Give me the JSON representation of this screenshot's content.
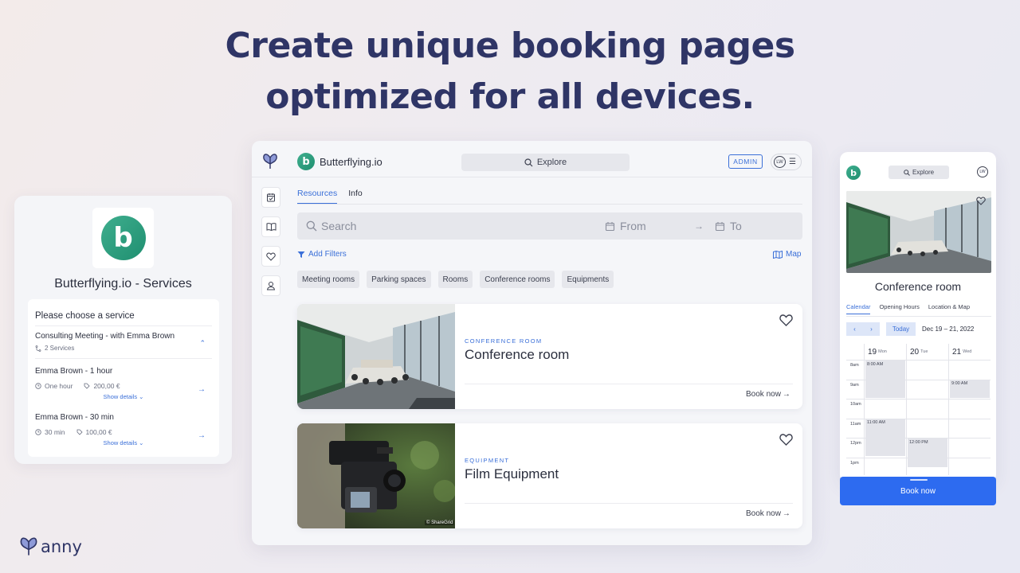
{
  "headline": {
    "line1": "Create unique booking pages",
    "line2": "optimized for all devices."
  },
  "left_panel": {
    "logo_letter": "b",
    "title": "Butterflying.io - Services",
    "card_heading": "Please choose a service",
    "group": {
      "name": "Consulting Meeting - with Emma Brown",
      "sub": "2 Services"
    },
    "services": [
      {
        "name": "Emma Brown - 1 hour",
        "duration": "One hour",
        "price": "200,00 €",
        "details": "Show details"
      },
      {
        "name": "Emma Brown - 30 min",
        "duration": "30 min",
        "price": "100,00 €",
        "details": "Show details"
      }
    ]
  },
  "browser": {
    "brand_letter": "b",
    "brand_name": "Butterflying.io",
    "explore": "Explore",
    "admin": "ADMIN",
    "user_initials": "LW",
    "tabs": [
      {
        "label": "Resources",
        "active": true
      },
      {
        "label": "Info",
        "active": false
      }
    ],
    "search": {
      "placeholder": "Search",
      "from": "From",
      "to": "To"
    },
    "add_filters": "Add Filters",
    "map": "Map",
    "chips": [
      "Meeting rooms",
      "Parking spaces",
      "Rooms",
      "Conference rooms",
      "Equipments"
    ],
    "resources": [
      {
        "category": "CONFERENCE ROOM",
        "name": "Conference room",
        "book": "Book now"
      },
      {
        "category": "EQUIPMENT",
        "name": "Film Equipment",
        "book": "Book now",
        "credit": "© ShareGrid"
      }
    ]
  },
  "mobile": {
    "logo_letter": "b",
    "explore": "Explore",
    "user_initials": "LW",
    "title": "Conference room",
    "tabs": [
      {
        "label": "Calendar",
        "active": true
      },
      {
        "label": "Opening Hours",
        "active": false
      },
      {
        "label": "Location & Map",
        "active": false
      }
    ],
    "today": "Today",
    "range": "Dec 19 – 21, 2022",
    "days": [
      {
        "num": "19",
        "name": "Mon"
      },
      {
        "num": "20",
        "name": "Tue"
      },
      {
        "num": "21",
        "name": "Wed"
      }
    ],
    "times": [
      "8am",
      "9am",
      "10am",
      "11am",
      "12pm",
      "1pm"
    ],
    "events": [
      {
        "label": "8:00 AM"
      },
      {
        "label": "11:00 AM"
      },
      {
        "label": "12:00 PM"
      },
      {
        "label": "9:00 AM"
      }
    ],
    "book": "Book now"
  },
  "footer": {
    "brand": "anny"
  },
  "colors": {
    "accent": "#3a6fd8",
    "brand_green": "#2a9e7f",
    "headline": "#2f3566",
    "cta": "#2d6bf0"
  }
}
